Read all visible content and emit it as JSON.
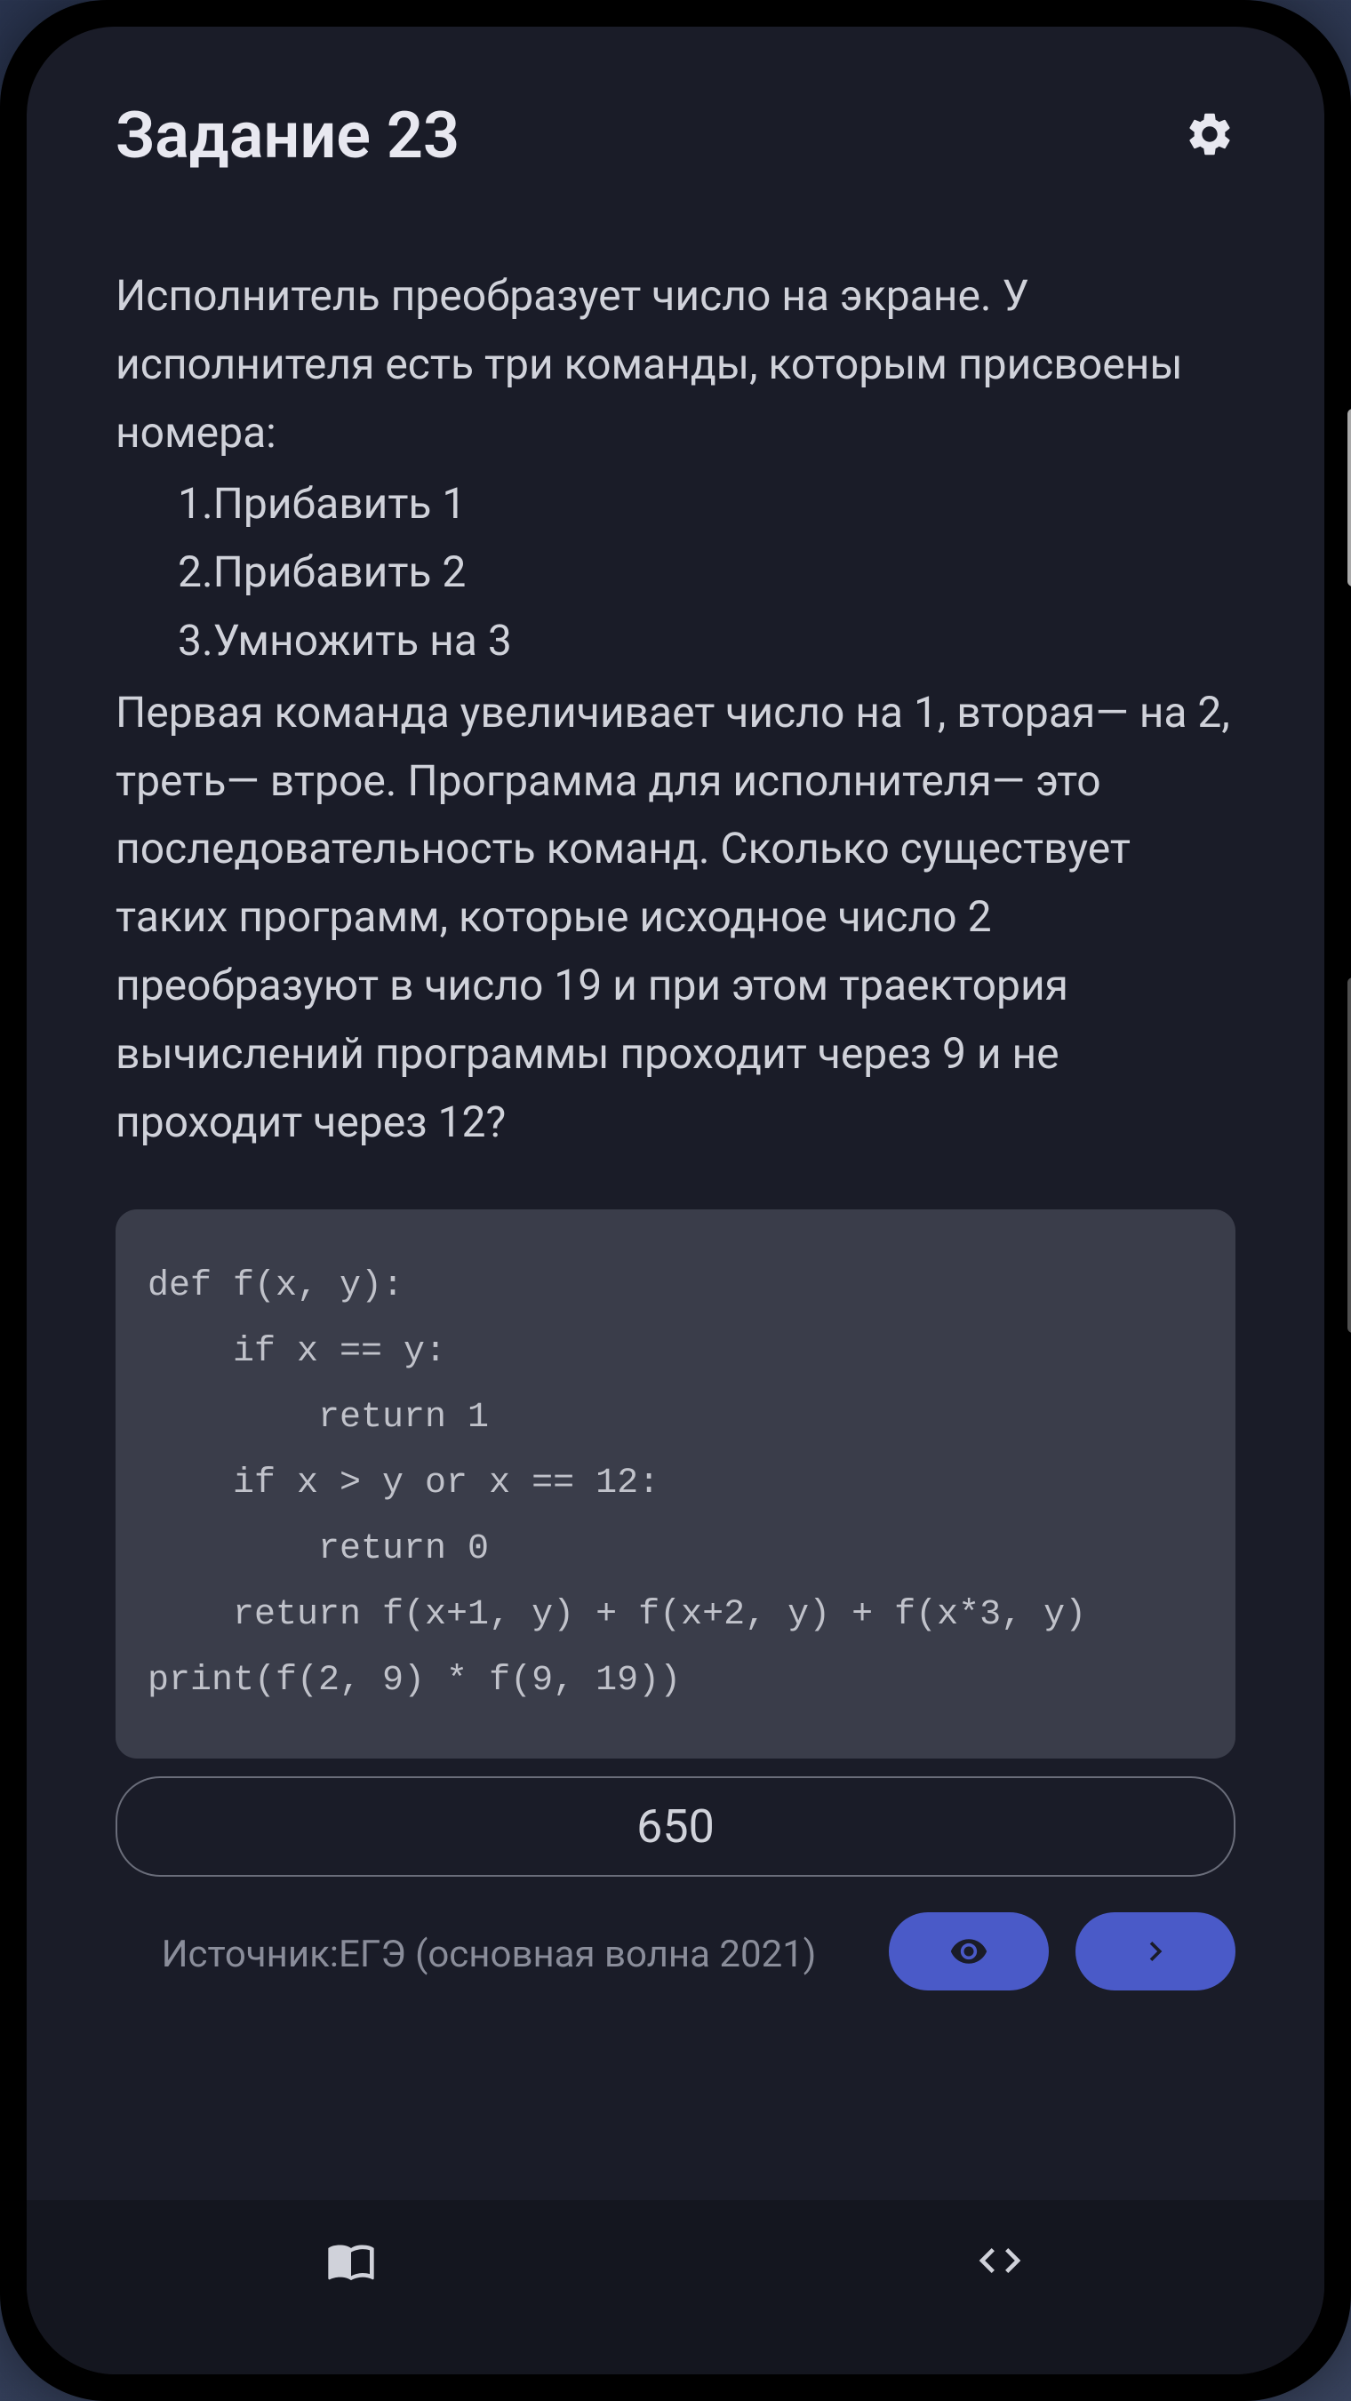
{
  "header": {
    "title": "Задание 23"
  },
  "problem": {
    "intro": "Исполнитель преобразует число на экране. У исполнителя есть три команды, которым присвоены номера:",
    "commands": [
      "1.Прибавить 1",
      "2.Прибавить 2",
      "3.Умножить на 3"
    ],
    "body": "Первая команда увеличивает число на 1, вторая— на 2, треть— втрое. Программа для исполнителя— это последовательность команд. Сколько существует таких программ, которые исходное число 2 преобразуют в число 19 и при этом траектория вычислений программы проходит через 9 и не проходит через 12?"
  },
  "code": "def f(x, y):\n    if x == y:\n        return 1\n    if x > y or x == 12:\n        return 0\n    return f(x+1, y) + f(x+2, y) + f(x*3, y)\nprint(f(2, 9) * f(9, 19))",
  "answer": {
    "value": "650"
  },
  "source": {
    "label": "Источник:",
    "text": "ЕГЭ (основная волна 2021)"
  },
  "icons": {
    "settings": "gear-icon",
    "view": "eye-icon",
    "next": "chevron-right-icon",
    "book": "book-icon",
    "code": "code-icon"
  }
}
